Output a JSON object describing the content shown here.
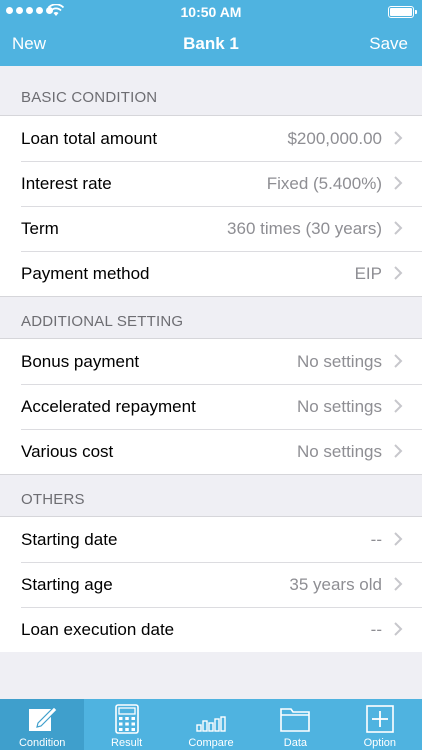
{
  "status": {
    "time": "10:50 AM"
  },
  "nav": {
    "left": "New",
    "title": "Bank 1",
    "right": "Save"
  },
  "sections": [
    {
      "header": "BASIC CONDITION",
      "rows": [
        {
          "label": "Loan total amount",
          "value": "$200,000.00"
        },
        {
          "label": "Interest rate",
          "value": "Fixed (5.400%)"
        },
        {
          "label": "Term",
          "value": "360 times (30 years)"
        },
        {
          "label": "Payment method",
          "value": "EIP"
        }
      ]
    },
    {
      "header": "ADDITIONAL SETTING",
      "rows": [
        {
          "label": "Bonus payment",
          "value": "No settings"
        },
        {
          "label": "Accelerated repayment",
          "value": "No settings"
        },
        {
          "label": "Various cost",
          "value": "No settings"
        }
      ]
    },
    {
      "header": "OTHERS",
      "rows": [
        {
          "label": "Starting date",
          "value": "--"
        },
        {
          "label": "Starting age",
          "value": "35 years old"
        },
        {
          "label": "Loan execution date",
          "value": "--"
        }
      ]
    }
  ],
  "tabs": [
    {
      "label": "Condition",
      "icon": "pencil-edit-icon",
      "active": true
    },
    {
      "label": "Result",
      "icon": "calculator-icon",
      "active": false
    },
    {
      "label": "Compare",
      "icon": "bar-chart-icon",
      "active": false
    },
    {
      "label": "Data",
      "icon": "folder-icon",
      "active": false
    },
    {
      "label": "Option",
      "icon": "plus-square-icon",
      "active": false
    }
  ],
  "colors": {
    "accent": "#4fb3e0",
    "active_tab": "#3f9fcc",
    "background": "#efeff4",
    "value_text": "#8e8e93"
  }
}
